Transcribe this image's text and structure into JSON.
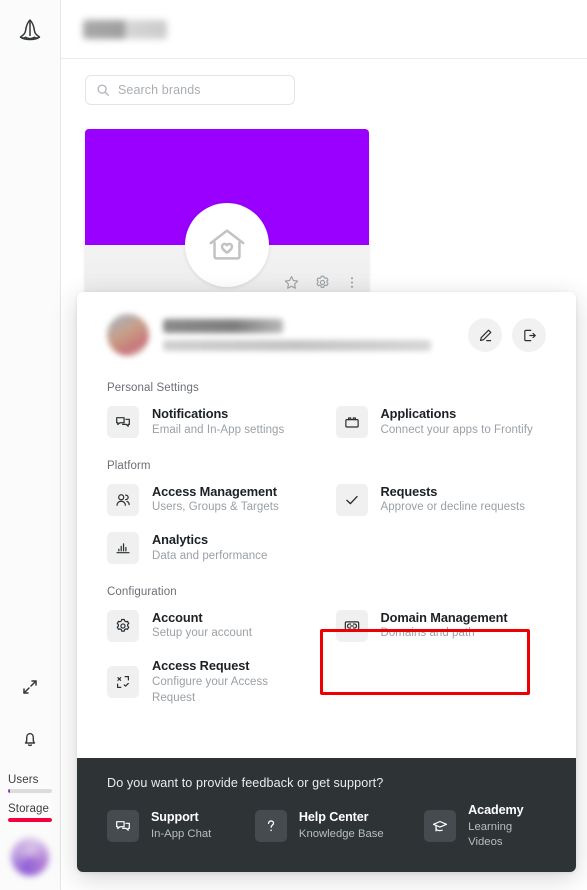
{
  "app": {
    "logo_icon": "frontify-logo-icon",
    "header_title": "",
    "header_title_redacted": true
  },
  "sidebar": {
    "expand_icon": "expand-arrows-icon",
    "notifications_icon": "bell-icon",
    "meters": [
      {
        "label": "Users",
        "fill_percent": 4,
        "color": "#8b3ad6",
        "track_color": "#dcdcdc"
      },
      {
        "label": "Storage",
        "fill_percent": 100,
        "color": "#f5003c",
        "track_color": "#dcdcdc"
      }
    ],
    "avatar": "user-avatar"
  },
  "search": {
    "placeholder": "Search brands",
    "value": "",
    "icon": "search-icon"
  },
  "brand_card": {
    "banner_color": "#9900ff",
    "logo_icon": "house-heart-icon",
    "actions": [
      {
        "name": "favorite-star-icon",
        "label": "Favorite"
      },
      {
        "name": "gear-icon",
        "label": "Settings"
      },
      {
        "name": "more-vertical-icon",
        "label": "More"
      }
    ]
  },
  "panel": {
    "profile": {
      "avatar": "profile-avatar",
      "name": "",
      "email": "",
      "redacted": true,
      "edit_icon": "pencil-icon",
      "logout_icon": "logout-icon"
    },
    "sections": [
      {
        "title": "Personal Settings",
        "items": [
          {
            "icon": "speech-bubbles-icon",
            "title": "Notifications",
            "subtitle": "Email and In-App settings",
            "highlighted": false
          },
          {
            "icon": "apps-block-icon",
            "title": "Applications",
            "subtitle": "Connect your apps to Frontify",
            "highlighted": false
          }
        ]
      },
      {
        "title": "Platform",
        "items": [
          {
            "icon": "users-group-icon",
            "title": "Access Management",
            "subtitle": "Users, Groups & Targets",
            "highlighted": false
          },
          {
            "icon": "check-icon",
            "title": "Requests",
            "subtitle": "Approve or decline requests",
            "highlighted": false
          },
          {
            "icon": "bar-chart-icon",
            "title": "Analytics",
            "subtitle": "Data and performance",
            "highlighted": false
          },
          {
            "icon": "",
            "title": "",
            "subtitle": "",
            "highlighted": false
          }
        ]
      },
      {
        "title": "Configuration",
        "items": [
          {
            "icon": "gear-icon",
            "title": "Account",
            "subtitle": "Setup your account",
            "highlighted": false
          },
          {
            "icon": "link-chain-icon",
            "title": "Domain Management",
            "subtitle": "Domains and path",
            "highlighted": true
          },
          {
            "icon": "access-request-icon",
            "title": "Access Request",
            "subtitle": "Configure your Access Request",
            "highlighted": false
          },
          {
            "icon": "",
            "title": "",
            "subtitle": "",
            "highlighted": false
          }
        ]
      }
    ],
    "footer": {
      "question": "Do you want to provide feedback or get support?",
      "items": [
        {
          "icon": "speech-bubbles-icon",
          "title": "Support",
          "subtitle": "In-App Chat"
        },
        {
          "icon": "question-mark-icon",
          "title": "Help Center",
          "subtitle": "Knowledge Base"
        },
        {
          "icon": "graduation-cap-icon",
          "title": "Academy",
          "subtitle": "Learning Videos"
        }
      ]
    }
  },
  "highlight": {
    "color": "#ee0000",
    "target": "Domain Management"
  }
}
